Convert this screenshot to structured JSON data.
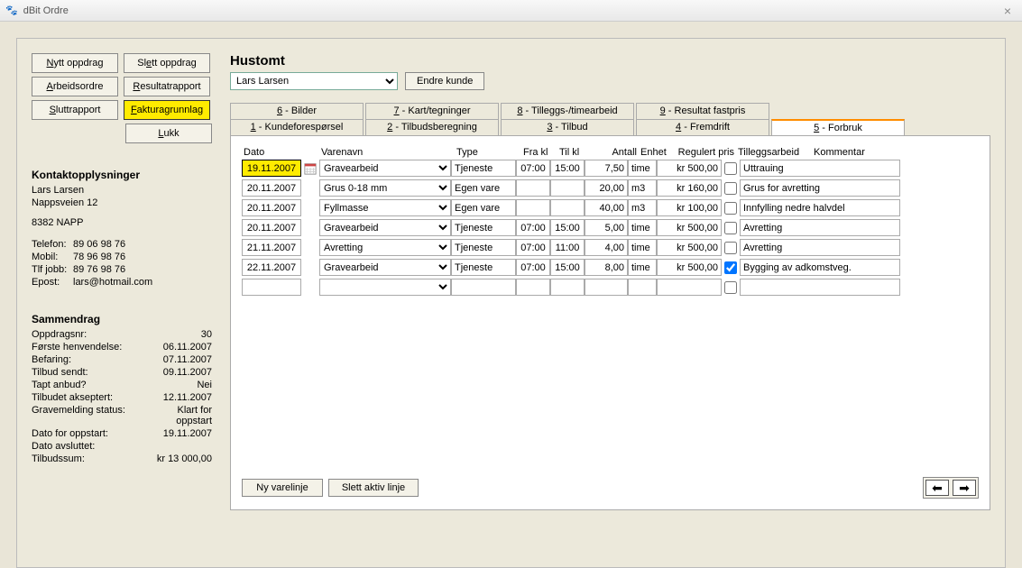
{
  "window": {
    "title": "dBit Ordre"
  },
  "sidebar": {
    "buttons": {
      "new": "Nytt oppdrag",
      "delete": "Slett oppdrag",
      "workorder": "Arbeidsordre",
      "resultreport": "Resultatrapport",
      "finalreport": "Sluttrapport",
      "invoice": "Fakturagrunnlag",
      "close": "Lukk"
    },
    "contact": {
      "heading": "Kontaktopplysninger",
      "name": "Lars Larsen",
      "address": "Nappsveien 12",
      "postal": "8382   NAPP",
      "phone_label": "Telefon:",
      "phone": "89 06 98 76",
      "mobile_label": "Mobil:",
      "mobile": "78 96 98 76",
      "work_label": "Tlf jobb:",
      "work": "89 76 98 76",
      "email_label": "Epost:",
      "email": "lars@hotmail.com"
    },
    "summary": {
      "heading": "Sammendrag",
      "rows": [
        {
          "k": "Oppdragsnr:",
          "v": "30"
        },
        {
          "k": "Første henvendelse:",
          "v": "06.11.2007"
        },
        {
          "k": "Befaring:",
          "v": "07.11.2007"
        },
        {
          "k": "Tilbud sendt:",
          "v": "09.11.2007"
        },
        {
          "k": "Tapt anbud?",
          "v": "Nei"
        },
        {
          "k": "Tilbudet akseptert:",
          "v": "12.11.2007"
        },
        {
          "k": "Gravemelding status:",
          "v": "Klart for oppstart"
        },
        {
          "k": "Dato for oppstart:",
          "v": "19.11.2007"
        },
        {
          "k": "Dato avsluttet:",
          "v": ""
        },
        {
          "k": "Tilbudssum:",
          "v": "kr 13 000,00"
        }
      ]
    }
  },
  "main": {
    "title": "Hustomt",
    "customer": "Lars Larsen",
    "change_customer": "Endre kunde",
    "tabs_row1": [
      {
        "n": "6",
        "l": "Bilder"
      },
      {
        "n": "7",
        "l": "Kart/tegninger"
      },
      {
        "n": "8",
        "l": "Tilleggs-/timearbeid"
      },
      {
        "n": "9",
        "l": "Resultat fastpris"
      }
    ],
    "tabs_row2": [
      {
        "n": "1",
        "l": "Kundeforespørsel"
      },
      {
        "n": "2",
        "l": "Tilbudsberegning"
      },
      {
        "n": "3",
        "l": "Tilbud"
      },
      {
        "n": "4",
        "l": "Fremdrift"
      },
      {
        "n": "5",
        "l": "Forbruk"
      }
    ],
    "headers": {
      "dato": "Dato",
      "varenavn": "Varenavn",
      "type": "Type",
      "frakl": "Fra kl",
      "tilkl": "Til kl",
      "antall": "Antall",
      "enhet": "Enhet",
      "pris": "Regulert pris",
      "tillegg": "Tilleggsarbeid",
      "kommentar": "Kommentar"
    },
    "rows": [
      {
        "dato": "19.11.2007",
        "hl": true,
        "vare": "Gravearbeid",
        "type": "Tjeneste",
        "fra": "07:00",
        "til": "15:00",
        "antall": "7,50",
        "enhet": "time",
        "pris": "kr 500,00",
        "chk": false,
        "kom": "Uttrauing"
      },
      {
        "dato": "20.11.2007",
        "hl": false,
        "vare": "Grus 0-18 mm",
        "type": "Egen vare",
        "fra": "",
        "til": "",
        "antall": "20,00",
        "enhet": "m3",
        "pris": "kr 160,00",
        "chk": false,
        "kom": "Grus for avretting"
      },
      {
        "dato": "20.11.2007",
        "hl": false,
        "vare": "Fyllmasse",
        "type": "Egen vare",
        "fra": "",
        "til": "",
        "antall": "40,00",
        "enhet": "m3",
        "pris": "kr 100,00",
        "chk": false,
        "kom": "Innfylling nedre halvdel"
      },
      {
        "dato": "20.11.2007",
        "hl": false,
        "vare": "Gravearbeid",
        "type": "Tjeneste",
        "fra": "07:00",
        "til": "15:00",
        "antall": "5,00",
        "enhet": "time",
        "pris": "kr 500,00",
        "chk": false,
        "kom": "Avretting"
      },
      {
        "dato": "21.11.2007",
        "hl": false,
        "vare": "Avretting",
        "type": "Tjeneste",
        "fra": "07:00",
        "til": "11:00",
        "antall": "4,00",
        "enhet": "time",
        "pris": "kr 500,00",
        "chk": false,
        "kom": "Avretting"
      },
      {
        "dato": "22.11.2007",
        "hl": false,
        "vare": "Gravearbeid",
        "type": "Tjeneste",
        "fra": "07:00",
        "til": "15:00",
        "antall": "8,00",
        "enhet": "time",
        "pris": "kr 500,00",
        "chk": true,
        "kom": "Bygging av adkomstveg."
      },
      {
        "dato": "",
        "hl": false,
        "vare": "",
        "type": "",
        "fra": "",
        "til": "",
        "antall": "",
        "enhet": "",
        "pris": "",
        "chk": false,
        "kom": ""
      }
    ],
    "bottom": {
      "new_line": "Ny varelinje",
      "delete_line": "Slett aktiv linje"
    }
  }
}
